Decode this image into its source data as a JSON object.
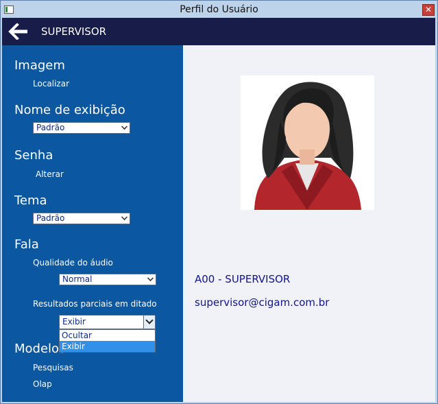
{
  "window": {
    "title": "Perfil do Usuário"
  },
  "appbar": {
    "title": "SUPERVISOR"
  },
  "sidebar": {
    "imagem": {
      "header": "Imagem",
      "action": "Localizar"
    },
    "nome": {
      "header": "Nome de exibição",
      "selected": "Padrão"
    },
    "senha": {
      "header": "Senha",
      "action": "Alterar"
    },
    "tema": {
      "header": "Tema",
      "selected": "Padrão"
    },
    "fala": {
      "header": "Fala",
      "qualidade_label": "Qualidade do áudio",
      "qualidade_selected": "Normal",
      "resultados_label": "Resultados parciais em ditado",
      "resultados_selected": "Exibir",
      "resultados_options": [
        "Ocultar",
        "Exibir"
      ]
    },
    "modelos": {
      "header": "Modelos",
      "items": [
        "Pesquisas",
        "Olap"
      ]
    }
  },
  "profile": {
    "code_name": "A00 - SUPERVISOR",
    "email": "supervisor@cigam.com.br"
  }
}
